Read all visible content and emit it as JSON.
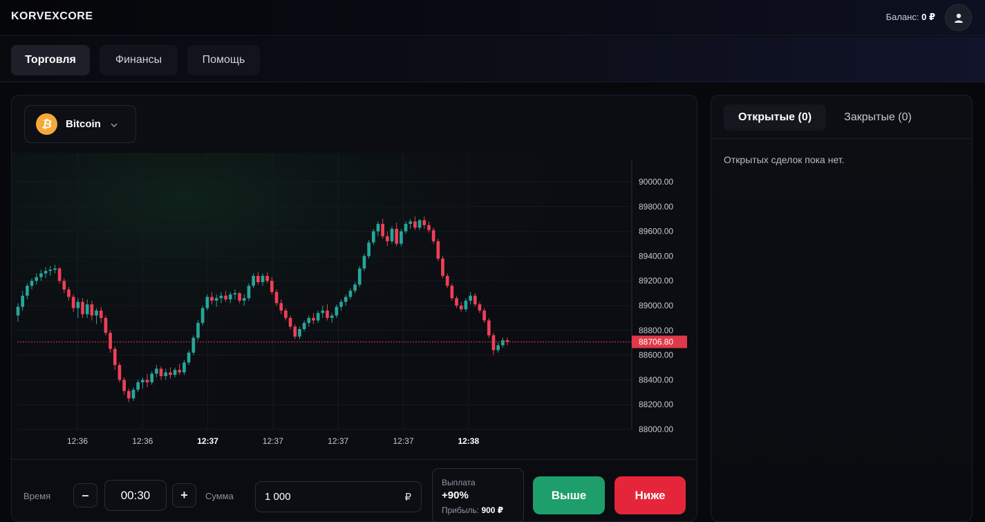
{
  "header": {
    "logo": "KORVEXCORE",
    "balance_label": "Баланс:",
    "balance_value": "0 ₽"
  },
  "nav": {
    "tabs": [
      {
        "label": "Торговля",
        "active": true
      },
      {
        "label": "Финансы",
        "active": false
      },
      {
        "label": "Помощь",
        "active": false
      }
    ]
  },
  "asset": {
    "name": "Bitcoin",
    "icon": "bitcoin-icon",
    "icon_color": "#f5a93a"
  },
  "chart_data": {
    "type": "candlestick",
    "y_ticks": [
      "90000.00",
      "89800.00",
      "89600.00",
      "89400.00",
      "89200.00",
      "89000.00",
      "88800.00",
      "88600.00",
      "88400.00",
      "88200.00",
      "88000.00"
    ],
    "ylim": [
      88000,
      90000
    ],
    "x_ticks": [
      {
        "label": "12:36",
        "bold": false
      },
      {
        "label": "12:36",
        "bold": false
      },
      {
        "label": "12:37",
        "bold": true
      },
      {
        "label": "12:37",
        "bold": false
      },
      {
        "label": "12:37",
        "bold": false
      },
      {
        "label": "12:37",
        "bold": false
      },
      {
        "label": "12:38",
        "bold": true
      }
    ],
    "current_price": "88706.80",
    "colors": {
      "up": "#26a69a",
      "down": "#ef4056",
      "price_line": "#e0394a"
    },
    "candles": [
      [
        88920,
        89020,
        88870,
        88990
      ],
      [
        88990,
        89120,
        88960,
        89080
      ],
      [
        89080,
        89180,
        89050,
        89160
      ],
      [
        89160,
        89220,
        89130,
        89200
      ],
      [
        89200,
        89260,
        89170,
        89230
      ],
      [
        89230,
        89290,
        89200,
        89260
      ],
      [
        89260,
        89310,
        89220,
        89280
      ],
      [
        89280,
        89320,
        89240,
        89290
      ],
      [
        89290,
        89330,
        89260,
        89300
      ],
      [
        89300,
        89310,
        89180,
        89200
      ],
      [
        89200,
        89220,
        89100,
        89130
      ],
      [
        89130,
        89150,
        89040,
        89070
      ],
      [
        89070,
        89090,
        88950,
        88980
      ],
      [
        88980,
        89060,
        88900,
        89030
      ],
      [
        89030,
        89060,
        88900,
        88930
      ],
      [
        88930,
        89050,
        88900,
        89010
      ],
      [
        89010,
        89040,
        88880,
        88920
      ],
      [
        88920,
        88980,
        88850,
        88960
      ],
      [
        88960,
        88990,
        88860,
        88900
      ],
      [
        88900,
        88920,
        88760,
        88780
      ],
      [
        88780,
        88800,
        88620,
        88650
      ],
      [
        88650,
        88670,
        88480,
        88520
      ],
      [
        88520,
        88540,
        88380,
        88400
      ],
      [
        88400,
        88420,
        88280,
        88310
      ],
      [
        88310,
        88330,
        88220,
        88250
      ],
      [
        88250,
        88340,
        88230,
        88320
      ],
      [
        88320,
        88400,
        88300,
        88380
      ],
      [
        88380,
        88420,
        88330,
        88400
      ],
      [
        88400,
        88450,
        88340,
        88380
      ],
      [
        88380,
        88470,
        88360,
        88450
      ],
      [
        88450,
        88520,
        88420,
        88490
      ],
      [
        88490,
        88510,
        88400,
        88430
      ],
      [
        88430,
        88490,
        88400,
        88460
      ],
      [
        88460,
        88500,
        88410,
        88440
      ],
      [
        88440,
        88500,
        88420,
        88480
      ],
      [
        88480,
        88530,
        88440,
        88460
      ],
      [
        88460,
        88560,
        88440,
        88540
      ],
      [
        88540,
        88640,
        88520,
        88620
      ],
      [
        88620,
        88760,
        88600,
        88740
      ],
      [
        88740,
        88880,
        88720,
        88860
      ],
      [
        88860,
        89000,
        88840,
        88980
      ],
      [
        88980,
        89090,
        88960,
        89070
      ],
      [
        89070,
        89110,
        89010,
        89040
      ],
      [
        89040,
        89090,
        88990,
        89060
      ],
      [
        89060,
        89110,
        89020,
        89080
      ],
      [
        89080,
        89120,
        89030,
        89050
      ],
      [
        89050,
        89110,
        89020,
        89090
      ],
      [
        89090,
        89130,
        89050,
        89100
      ],
      [
        89100,
        89110,
        89020,
        89040
      ],
      [
        89040,
        89090,
        89000,
        89060
      ],
      [
        89060,
        89180,
        89040,
        89160
      ],
      [
        89160,
        89260,
        89140,
        89240
      ],
      [
        89240,
        89270,
        89170,
        89190
      ],
      [
        89190,
        89260,
        89160,
        89240
      ],
      [
        89240,
        89270,
        89180,
        89200
      ],
      [
        89200,
        89230,
        89090,
        89110
      ],
      [
        89110,
        89130,
        89000,
        89020
      ],
      [
        89020,
        89050,
        88930,
        88960
      ],
      [
        88960,
        88980,
        88880,
        88900
      ],
      [
        88900,
        88920,
        88810,
        88830
      ],
      [
        88830,
        88850,
        88730,
        88750
      ],
      [
        88750,
        88830,
        88730,
        88810
      ],
      [
        88810,
        88880,
        88790,
        88860
      ],
      [
        88860,
        88920,
        88830,
        88900
      ],
      [
        88900,
        88940,
        88850,
        88880
      ],
      [
        88880,
        88960,
        88860,
        88940
      ],
      [
        88940,
        89000,
        88900,
        88960
      ],
      [
        88960,
        89010,
        88880,
        88900
      ],
      [
        88900,
        88940,
        88860,
        88920
      ],
      [
        88920,
        89010,
        88900,
        88990
      ],
      [
        88990,
        89050,
        88960,
        89030
      ],
      [
        89030,
        89090,
        89000,
        89070
      ],
      [
        89070,
        89140,
        89050,
        89120
      ],
      [
        89120,
        89190,
        89100,
        89170
      ],
      [
        89170,
        89320,
        89150,
        89300
      ],
      [
        89300,
        89420,
        89280,
        89400
      ],
      [
        89400,
        89530,
        89380,
        89510
      ],
      [
        89510,
        89620,
        89490,
        89600
      ],
      [
        89600,
        89680,
        89560,
        89660
      ],
      [
        89660,
        89700,
        89540,
        89560
      ],
      [
        89560,
        89600,
        89480,
        89520
      ],
      [
        89520,
        89640,
        89500,
        89620
      ],
      [
        89620,
        89670,
        89480,
        89500
      ],
      [
        89500,
        89620,
        89480,
        89600
      ],
      [
        89600,
        89680,
        89580,
        89660
      ],
      [
        89660,
        89700,
        89620,
        89680
      ],
      [
        89680,
        89720,
        89610,
        89630
      ],
      [
        89630,
        89700,
        89610,
        89690
      ],
      [
        89690,
        89720,
        89620,
        89650
      ],
      [
        89650,
        89680,
        89590,
        89610
      ],
      [
        89610,
        89630,
        89500,
        89520
      ],
      [
        89520,
        89540,
        89360,
        89380
      ],
      [
        89380,
        89400,
        89220,
        89240
      ],
      [
        89240,
        89260,
        89140,
        89160
      ],
      [
        89160,
        89180,
        89040,
        89060
      ],
      [
        89060,
        89080,
        88980,
        89000
      ],
      [
        89000,
        89030,
        88950,
        88970
      ],
      [
        88970,
        89060,
        88950,
        89040
      ],
      [
        89040,
        89110,
        89010,
        89080
      ],
      [
        89080,
        89100,
        88990,
        89010
      ],
      [
        89010,
        89030,
        88940,
        88960
      ],
      [
        88960,
        88980,
        88860,
        88880
      ],
      [
        88880,
        88900,
        88740,
        88760
      ],
      [
        88760,
        88780,
        88600,
        88640
      ],
      [
        88640,
        88700,
        88620,
        88680
      ],
      [
        88680,
        88740,
        88660,
        88720
      ],
      [
        88720,
        88740,
        88680,
        88706.8
      ]
    ]
  },
  "trade": {
    "time_label": "Время",
    "minus_label": "–",
    "time_value": "00:30",
    "plus_label": "+",
    "amount_label": "Сумма",
    "amount_value": "1 000",
    "currency": "₽",
    "payout_label": "Выплата",
    "payout_value": "+90%",
    "profit_label": "Прибыль:",
    "profit_value": "900 ₽",
    "up_label": "Выше",
    "down_label": "Ниже",
    "up_color": "#1e9e6a",
    "down_color": "#e5263a"
  },
  "deals": {
    "tabs": [
      {
        "label": "Открытые (0)",
        "active": true
      },
      {
        "label": "Закрытые (0)",
        "active": false
      }
    ],
    "empty_message": "Открытых сделок пока нет."
  }
}
